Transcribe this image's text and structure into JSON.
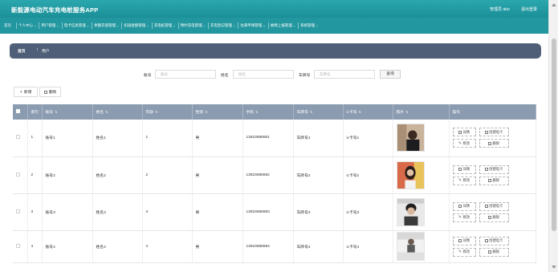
{
  "app": {
    "title": "新能源电动汽车充电桩服务APP",
    "user_label": "管理员 abo",
    "logout_label": "退出登录"
  },
  "nav": [
    {
      "label": "首页",
      "chevron": false
    },
    {
      "label": "个人中心",
      "chevron": true
    },
    {
      "label": "用户管理",
      "chevron": true
    },
    {
      "label": "电卡信息管理",
      "chevron": true
    },
    {
      "label": "余额充值管理",
      "chevron": true
    },
    {
      "label": "扣减金额管理",
      "chevron": true
    },
    {
      "label": "充电桩管理",
      "chevron": true
    },
    {
      "label": "预约充电管理",
      "chevron": true
    },
    {
      "label": "充电登记管理",
      "chevron": true
    },
    {
      "label": "往来申请管理",
      "chevron": true
    },
    {
      "label": "故障上报管理",
      "chevron": true
    },
    {
      "label": "系统管理",
      "chevron": true
    }
  ],
  "breadcrumb": {
    "home": "首页",
    "separator": "/",
    "current": "用户"
  },
  "search": {
    "fields": [
      {
        "label": "账号",
        "placeholder": "账号"
      },
      {
        "label": "姓名",
        "placeholder": "姓名"
      },
      {
        "label": "车牌号",
        "placeholder": "车牌号"
      }
    ],
    "button_label": "查询"
  },
  "toolbar": {
    "add_label": "新增",
    "delete_label": "删除"
  },
  "table": {
    "headers": [
      "索引",
      "账号",
      "姓名",
      "年龄",
      "性别",
      "手机",
      "车牌号",
      "ic卡号",
      "照片",
      "操作"
    ],
    "rows": [
      {
        "index": "1",
        "account": "账号1",
        "name": "姓名1",
        "age": "1",
        "gender": "男",
        "phone": "13823888881",
        "plate": "车牌号1",
        "ic_card": "ic卡号1"
      },
      {
        "index": "2",
        "account": "账号2",
        "name": "姓名2",
        "age": "2",
        "gender": "男",
        "phone": "13823888882",
        "plate": "车牌号2",
        "ic_card": "ic卡号2"
      },
      {
        "index": "3",
        "account": "账号3",
        "name": "姓名3",
        "age": "3",
        "gender": "男",
        "phone": "13823888883",
        "plate": "车牌号3",
        "ic_card": "ic卡号3"
      },
      {
        "index": "4",
        "account": "账号4",
        "name": "姓名4",
        "age": "4",
        "gender": "男",
        "phone": "13823888884",
        "plate": "车牌号4",
        "ic_card": "ic卡号4"
      }
    ],
    "actions": {
      "detail": "详情",
      "create_card": "创建电卡",
      "edit": "修改",
      "delete": "删除"
    }
  },
  "colors": {
    "header_teal": "#1b8f98",
    "nav_teal": "#22979f",
    "breadcrumb_bg": "#4e5f77",
    "table_header": "#8b9bb0"
  }
}
